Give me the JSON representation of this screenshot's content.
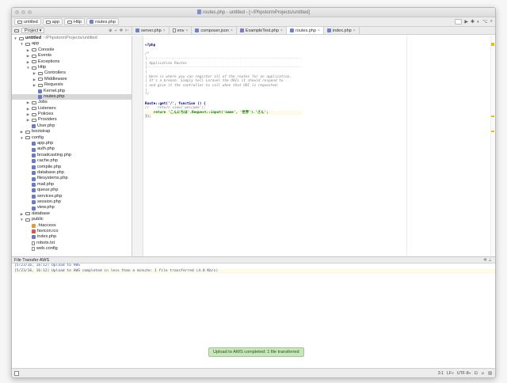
{
  "window": {
    "title": "routes.php - untitled - [~/PhpstormProjects/untitled]"
  },
  "navbar": {
    "crumbs": [
      "untitled",
      "app",
      "Http",
      "routes.php"
    ]
  },
  "project_panel": {
    "label": "Project"
  },
  "tabs": [
    {
      "label": "server.php",
      "active": false
    },
    {
      "label": "env",
      "active": false
    },
    {
      "label": "composer.json",
      "active": false
    },
    {
      "label": "ExampleTest.php",
      "active": false
    },
    {
      "label": "routes.php",
      "active": true
    },
    {
      "label": "index.php",
      "active": false
    }
  ],
  "tree": [
    {
      "depth": 0,
      "arrow": "▼",
      "icon": "folder",
      "label": "untitled",
      "muted": "~/PhpstormProjects/untitled",
      "bold": true
    },
    {
      "depth": 1,
      "arrow": "▼",
      "icon": "folder",
      "label": "app"
    },
    {
      "depth": 2,
      "arrow": "▶",
      "icon": "folder",
      "label": "Console"
    },
    {
      "depth": 2,
      "arrow": "▶",
      "icon": "folder",
      "label": "Events"
    },
    {
      "depth": 2,
      "arrow": "▶",
      "icon": "folder",
      "label": "Exceptions"
    },
    {
      "depth": 2,
      "arrow": "▼",
      "icon": "folder",
      "label": "Http"
    },
    {
      "depth": 3,
      "arrow": "▶",
      "icon": "folder",
      "label": "Controllers"
    },
    {
      "depth": 3,
      "arrow": "▶",
      "icon": "folder",
      "label": "Middleware"
    },
    {
      "depth": 3,
      "arrow": "▶",
      "icon": "folder",
      "label": "Requests"
    },
    {
      "depth": 3,
      "arrow": "",
      "icon": "php",
      "label": "Kernel.php"
    },
    {
      "depth": 3,
      "arrow": "",
      "icon": "php",
      "label": "routes.php",
      "selected": true
    },
    {
      "depth": 2,
      "arrow": "▶",
      "icon": "folder",
      "label": "Jobs"
    },
    {
      "depth": 2,
      "arrow": "▶",
      "icon": "folder",
      "label": "Listeners"
    },
    {
      "depth": 2,
      "arrow": "▶",
      "icon": "folder",
      "label": "Policies"
    },
    {
      "depth": 2,
      "arrow": "▶",
      "icon": "folder",
      "label": "Providers"
    },
    {
      "depth": 2,
      "arrow": "",
      "icon": "php",
      "label": "User.php"
    },
    {
      "depth": 1,
      "arrow": "▶",
      "icon": "folder",
      "label": "bootstrap"
    },
    {
      "depth": 1,
      "arrow": "▼",
      "icon": "folder",
      "label": "config"
    },
    {
      "depth": 2,
      "arrow": "",
      "icon": "php",
      "label": "app.php"
    },
    {
      "depth": 2,
      "arrow": "",
      "icon": "php",
      "label": "auth.php"
    },
    {
      "depth": 2,
      "arrow": "",
      "icon": "php",
      "label": "broadcasting.php"
    },
    {
      "depth": 2,
      "arrow": "",
      "icon": "php",
      "label": "cache.php"
    },
    {
      "depth": 2,
      "arrow": "",
      "icon": "php",
      "label": "compile.php"
    },
    {
      "depth": 2,
      "arrow": "",
      "icon": "php",
      "label": "database.php"
    },
    {
      "depth": 2,
      "arrow": "",
      "icon": "php",
      "label": "filesystems.php"
    },
    {
      "depth": 2,
      "arrow": "",
      "icon": "php",
      "label": "mail.php"
    },
    {
      "depth": 2,
      "arrow": "",
      "icon": "php",
      "label": "queue.php"
    },
    {
      "depth": 2,
      "arrow": "",
      "icon": "php",
      "label": "services.php"
    },
    {
      "depth": 2,
      "arrow": "",
      "icon": "php",
      "label": "session.php"
    },
    {
      "depth": 2,
      "arrow": "",
      "icon": "php",
      "label": "view.php"
    },
    {
      "depth": 1,
      "arrow": "▶",
      "icon": "folder",
      "label": "database"
    },
    {
      "depth": 1,
      "arrow": "▼",
      "icon": "folder",
      "label": "public"
    },
    {
      "depth": 2,
      "arrow": "",
      "icon": "file-orange",
      "label": ".htaccess"
    },
    {
      "depth": 2,
      "arrow": "",
      "icon": "file-red",
      "label": "favicon.ico"
    },
    {
      "depth": 2,
      "arrow": "",
      "icon": "php",
      "label": "index.php"
    },
    {
      "depth": 2,
      "arrow": "",
      "icon": "file",
      "label": "robots.txt"
    },
    {
      "depth": 2,
      "arrow": "",
      "icon": "file",
      "label": "web.config"
    }
  ],
  "code_lines": [
    {
      "kind": "tag",
      "text": "<?php"
    },
    {
      "kind": "plain",
      "text": ""
    },
    {
      "kind": "comment",
      "text": "/*"
    },
    {
      "kind": "comment",
      "text": "|--------------------------------------------------------------------------"
    },
    {
      "kind": "comment",
      "text": "| Application Routes"
    },
    {
      "kind": "comment",
      "text": "|--------------------------------------------------------------------------"
    },
    {
      "kind": "comment",
      "text": "|"
    },
    {
      "kind": "comment",
      "text": "| Here is where you can register all of the routes for an application."
    },
    {
      "kind": "comment",
      "text": "| It's a breeze. Simply tell Laravel the URIs it should respond to"
    },
    {
      "kind": "comment",
      "text": "| and give it the controller to call when that URI is requested."
    },
    {
      "kind": "comment",
      "text": "|"
    },
    {
      "kind": "comment",
      "text": "*/"
    },
    {
      "kind": "plain",
      "text": ""
    },
    {
      "kind": "route",
      "text": "Route::get('/', function () {"
    },
    {
      "kind": "comment",
      "text": "//    return view('welcome');"
    },
    {
      "kind": "highlight",
      "text": "    return 'こんにちは'.Request::input('name', '世界').'さん';"
    },
    {
      "kind": "plain",
      "text": "});"
    }
  ],
  "file_transfer": {
    "title": "File Transfer AWS",
    "lines": [
      "[5/23/16, 16:12] Upload to AWS",
      "[5/23/16, 16:12] Upload to AWS completed in less than a minute: 1 file transferred (4.8 Kb/s)"
    ]
  },
  "toast": {
    "text": "Upload to AWS completed: 1 file transferred"
  },
  "status": {
    "position": "3:1",
    "line_sep": "LF÷",
    "encoding": "UTF-8÷"
  }
}
